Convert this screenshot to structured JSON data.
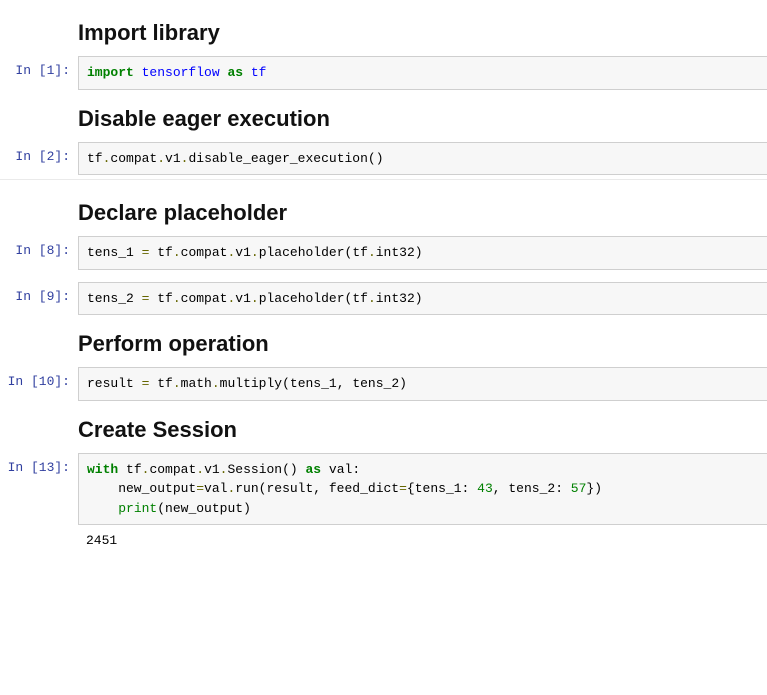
{
  "sections": [
    {
      "heading": "Import library",
      "cells": [
        {
          "prompt": "In [1]:",
          "code_tokens": [
            {
              "t": "import",
              "c": "kw-green"
            },
            {
              "t": " "
            },
            {
              "t": "tensorflow",
              "c": "kw-blue"
            },
            {
              "t": " "
            },
            {
              "t": "as",
              "c": "kw-green"
            },
            {
              "t": " "
            },
            {
              "t": "tf",
              "c": "kw-blue"
            }
          ]
        }
      ]
    },
    {
      "heading": "Disable eager execution",
      "cells": [
        {
          "prompt": "In [2]:",
          "code_tokens": [
            {
              "t": "tf"
            },
            {
              "t": ".",
              "c": "op"
            },
            {
              "t": "compat"
            },
            {
              "t": ".",
              "c": "op"
            },
            {
              "t": "v1"
            },
            {
              "t": ".",
              "c": "op"
            },
            {
              "t": "disable_eager_execution"
            },
            {
              "t": "()"
            }
          ]
        }
      ],
      "sep_after": true
    },
    {
      "heading": "Declare placeholder",
      "cells": [
        {
          "prompt": "In [8]:",
          "code_tokens": [
            {
              "t": "tens_1 "
            },
            {
              "t": "=",
              "c": "op"
            },
            {
              "t": " tf"
            },
            {
              "t": ".",
              "c": "op"
            },
            {
              "t": "compat"
            },
            {
              "t": ".",
              "c": "op"
            },
            {
              "t": "v1"
            },
            {
              "t": ".",
              "c": "op"
            },
            {
              "t": "placeholder"
            },
            {
              "t": "("
            },
            {
              "t": "tf"
            },
            {
              "t": ".",
              "c": "op"
            },
            {
              "t": "int32"
            },
            {
              "t": ")"
            }
          ]
        },
        {
          "prompt": "In [9]:",
          "code_tokens": [
            {
              "t": "tens_2 "
            },
            {
              "t": "=",
              "c": "op"
            },
            {
              "t": " tf"
            },
            {
              "t": ".",
              "c": "op"
            },
            {
              "t": "compat"
            },
            {
              "t": ".",
              "c": "op"
            },
            {
              "t": "v1"
            },
            {
              "t": ".",
              "c": "op"
            },
            {
              "t": "placeholder"
            },
            {
              "t": "("
            },
            {
              "t": "tf"
            },
            {
              "t": ".",
              "c": "op"
            },
            {
              "t": "int32"
            },
            {
              "t": ")"
            }
          ]
        }
      ]
    },
    {
      "heading": "Perform operation",
      "cells": [
        {
          "prompt": "In [10]:",
          "code_tokens": [
            {
              "t": "result "
            },
            {
              "t": "=",
              "c": "op"
            },
            {
              "t": " tf"
            },
            {
              "t": ".",
              "c": "op"
            },
            {
              "t": "math"
            },
            {
              "t": ".",
              "c": "op"
            },
            {
              "t": "multiply"
            },
            {
              "t": "("
            },
            {
              "t": "tens_1"
            },
            {
              "t": ", "
            },
            {
              "t": "tens_2"
            },
            {
              "t": ")"
            }
          ]
        }
      ]
    },
    {
      "heading": "Create Session",
      "cells": [
        {
          "prompt": "In [13]:",
          "code_tokens": [
            {
              "t": "with",
              "c": "kw-green"
            },
            {
              "t": " tf"
            },
            {
              "t": ".",
              "c": "op"
            },
            {
              "t": "compat"
            },
            {
              "t": ".",
              "c": "op"
            },
            {
              "t": "v1"
            },
            {
              "t": ".",
              "c": "op"
            },
            {
              "t": "Session"
            },
            {
              "t": "() "
            },
            {
              "t": "as",
              "c": "kw-green"
            },
            {
              "t": " val:"
            },
            {
              "t": "\n    new_output"
            },
            {
              "t": "=",
              "c": "op"
            },
            {
              "t": "val"
            },
            {
              "t": ".",
              "c": "op"
            },
            {
              "t": "run"
            },
            {
              "t": "("
            },
            {
              "t": "result"
            },
            {
              "t": ", feed_dict"
            },
            {
              "t": "=",
              "c": "op"
            },
            {
              "t": "{"
            },
            {
              "t": "tens_1"
            },
            {
              "t": ": "
            },
            {
              "t": "43",
              "c": "num"
            },
            {
              "t": ", "
            },
            {
              "t": "tens_2"
            },
            {
              "t": ": "
            },
            {
              "t": "57",
              "c": "num"
            },
            {
              "t": "})"
            },
            {
              "t": "\n    "
            },
            {
              "t": "print",
              "c": "builtin"
            },
            {
              "t": "("
            },
            {
              "t": "new_output"
            },
            {
              "t": ")"
            }
          ],
          "output": "2451"
        }
      ]
    }
  ]
}
